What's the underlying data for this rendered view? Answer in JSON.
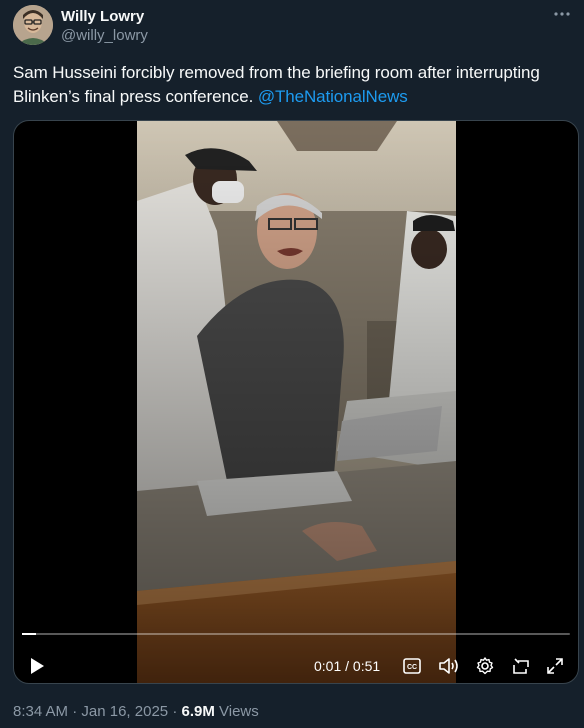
{
  "author": {
    "display_name": "Willy Lowry",
    "handle": "@willy_lowry"
  },
  "tweet": {
    "text": "Sam Husseini forcibly removed from the briefing room after interrupting Blinken’s final press conference. ",
    "mention": "@TheNationalNews"
  },
  "video": {
    "current_time": "0:01",
    "separator": "/",
    "duration": "0:51",
    "progress_fraction": 0.025,
    "cc_label": "CC"
  },
  "meta": {
    "time": "8:34 AM",
    "date": "Jan 16, 2025",
    "views_count": "6.9M",
    "views_label": "Views"
  },
  "colors": {
    "background": "#15202b",
    "accent": "#1d9bf0",
    "secondary_text": "#8b98a5"
  }
}
